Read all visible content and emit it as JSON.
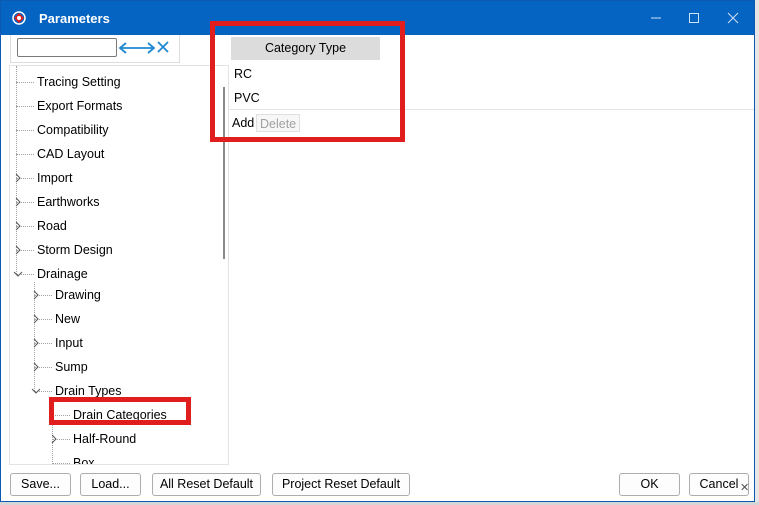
{
  "window": {
    "title": "Parameters"
  },
  "search": {
    "value": "",
    "placeholder": ""
  },
  "icons": {
    "app": "app-icon",
    "minimize": "minimize-icon",
    "maximize": "maximize-icon",
    "close": "close-icon",
    "expand_all": "horizontal-double-arrow-icon",
    "clear": "x-icon"
  },
  "colors": {
    "titlebar": "#0563c1",
    "accent": "#1e88d2",
    "highlight": "#e01e1e"
  },
  "tree": {
    "items": [
      {
        "label": "Tracing Setting",
        "level": 0,
        "expander": "none"
      },
      {
        "label": "Export Formats",
        "level": 0,
        "expander": "none"
      },
      {
        "label": "Compatibility",
        "level": 0,
        "expander": "none"
      },
      {
        "label": "CAD Layout",
        "level": 0,
        "expander": "none"
      },
      {
        "label": "Import",
        "level": 0,
        "expander": "collapsed"
      },
      {
        "label": "Earthworks",
        "level": 0,
        "expander": "collapsed"
      },
      {
        "label": "Road",
        "level": 0,
        "expander": "collapsed"
      },
      {
        "label": "Storm Design",
        "level": 0,
        "expander": "collapsed"
      },
      {
        "label": "Drainage",
        "level": 0,
        "expander": "expanded"
      },
      {
        "label": "Drawing",
        "level": 1,
        "expander": "collapsed"
      },
      {
        "label": "New",
        "level": 1,
        "expander": "collapsed"
      },
      {
        "label": "Input",
        "level": 1,
        "expander": "collapsed"
      },
      {
        "label": "Sump",
        "level": 1,
        "expander": "collapsed"
      },
      {
        "label": "Drain Types",
        "level": 1,
        "expander": "expanded"
      },
      {
        "label": "Drain Categories",
        "level": 2,
        "expander": "none"
      },
      {
        "label": "Half-Round",
        "level": 2,
        "expander": "collapsed"
      },
      {
        "label": "Box",
        "level": 2,
        "expander": "none"
      }
    ]
  },
  "category_table": {
    "header": "Category Type",
    "rows": [
      "RC",
      "PVC"
    ],
    "add_label": "Add",
    "delete_label": "Delete"
  },
  "footer": {
    "save": "Save...",
    "load": "Load...",
    "all_reset": "All Reset Default",
    "project_reset": "Project Reset Default",
    "ok": "OK",
    "cancel": "Cancel"
  }
}
